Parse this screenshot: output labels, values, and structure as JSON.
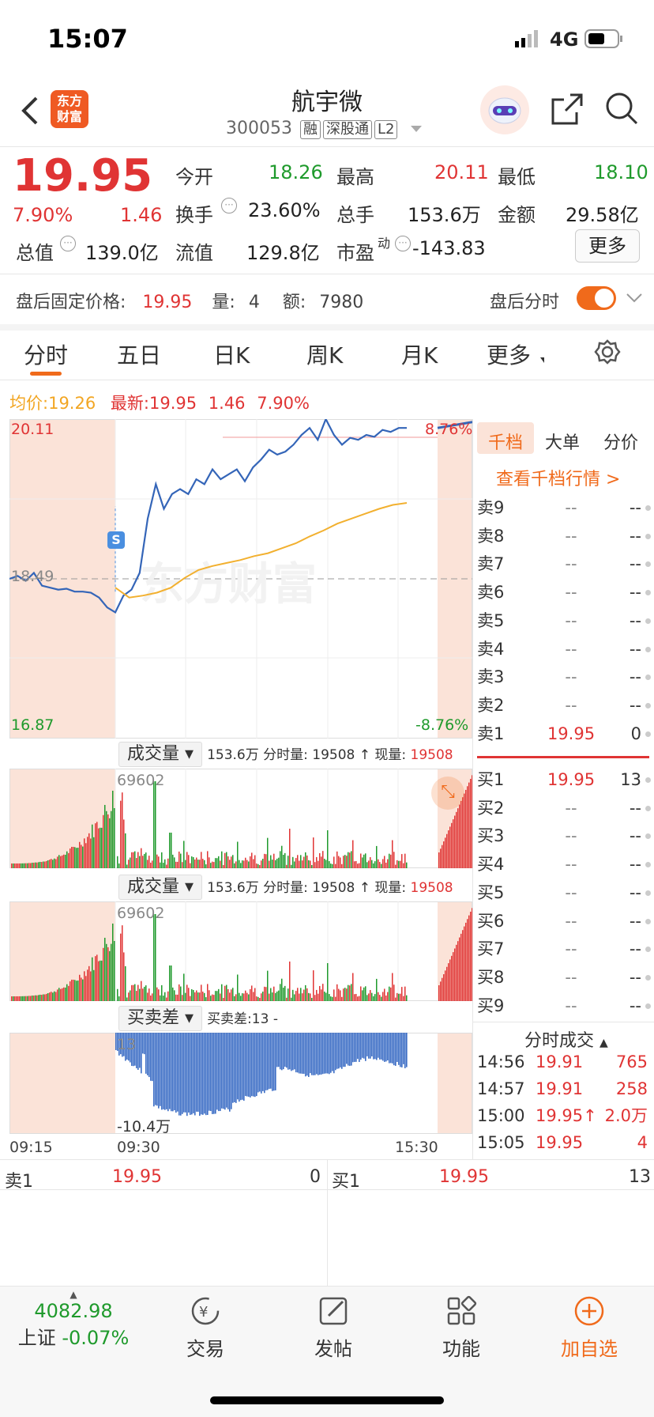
{
  "status": {
    "time": "15:07",
    "network": "4G"
  },
  "header": {
    "title": "航宇微",
    "code": "300053",
    "tags": [
      "融",
      "深股通",
      "L2"
    ],
    "logo": "东方财富"
  },
  "quote": {
    "price": "19.95",
    "pct": "7.90%",
    "chg": "1.46",
    "open_l": "今开",
    "open": "18.26",
    "high_l": "最高",
    "high": "20.11",
    "low_l": "最低",
    "low": "18.10",
    "turn_l": "换手",
    "turn": "23.60%",
    "vol_l": "总手",
    "vol": "153.6万",
    "amt_l": "金额",
    "amt": "29.58亿",
    "mcap_l": "总值",
    "mcap": "139.0亿",
    "float_l": "流值",
    "float": "129.8亿",
    "pe_l": "市盈",
    "pe_sup": "动",
    "pe": "-143.83",
    "more": "更多"
  },
  "afterhours": {
    "label": "盘后固定价格:",
    "price": "19.95",
    "vol_l": "量:",
    "vol": "4",
    "amt_l": "额:",
    "amt": "7980",
    "toggle_label": "盘后分时",
    "toggle_on": true
  },
  "tabs": [
    "分时",
    "五日",
    "日K",
    "周K",
    "月K",
    "更多"
  ],
  "legend": {
    "avg_l": "均价:",
    "avg": "19.26",
    "last_l": "最新:",
    "last": "19.95",
    "chg": "1.46",
    "pct": "7.90%"
  },
  "chart_axes": {
    "ymax": "20.11",
    "ymid": "18.49",
    "ymin": "16.87",
    "pmax": "8.76%",
    "pmin": "-8.76%",
    "t0": "09:15",
    "t1": "09:30",
    "t2": "15:30",
    "watermark": "东方财富",
    "marker": "S"
  },
  "vol_header": {
    "sel": "成交量",
    "text1": "153.6万 分时量: 19508 ↑ 现量: ",
    "cur": "19508",
    "max": "69602"
  },
  "diff_header": {
    "sel": "买卖差",
    "text": "买卖差:13 -",
    "top": "13",
    "bottom": "-10.4万"
  },
  "book_tabs": [
    "千档",
    "大单",
    "分价"
  ],
  "book_link": "查看千档行情 >",
  "sells": [
    {
      "k": "卖9",
      "p": "--",
      "q": "--"
    },
    {
      "k": "卖8",
      "p": "--",
      "q": "--"
    },
    {
      "k": "卖7",
      "p": "--",
      "q": "--"
    },
    {
      "k": "卖6",
      "p": "--",
      "q": "--"
    },
    {
      "k": "卖5",
      "p": "--",
      "q": "--"
    },
    {
      "k": "卖4",
      "p": "--",
      "q": "--"
    },
    {
      "k": "卖3",
      "p": "--",
      "q": "--"
    },
    {
      "k": "卖2",
      "p": "--",
      "q": "--"
    },
    {
      "k": "卖1",
      "p": "19.95",
      "q": "0"
    }
  ],
  "buys": [
    {
      "k": "买1",
      "p": "19.95",
      "q": "13"
    },
    {
      "k": "买2",
      "p": "--",
      "q": "--"
    },
    {
      "k": "买3",
      "p": "--",
      "q": "--"
    },
    {
      "k": "买4",
      "p": "--",
      "q": "--"
    },
    {
      "k": "买5",
      "p": "--",
      "q": "--"
    },
    {
      "k": "买6",
      "p": "--",
      "q": "--"
    },
    {
      "k": "买7",
      "p": "--",
      "q": "--"
    },
    {
      "k": "买8",
      "p": "--",
      "q": "--"
    },
    {
      "k": "买9",
      "p": "--",
      "q": "--"
    }
  ],
  "ticks_title": "分时成交",
  "ticks": [
    {
      "t": "14:56",
      "p": "19.91",
      "q": "765"
    },
    {
      "t": "14:57",
      "p": "19.91",
      "q": "258"
    },
    {
      "t": "15:00",
      "p": "19.95↑",
      "q": "2.0万"
    },
    {
      "t": "15:05",
      "p": "19.95",
      "q": "4"
    }
  ],
  "level1": {
    "sell_l": "卖1",
    "sell_p": "19.95",
    "sell_q": "0",
    "buy_l": "买1",
    "buy_p": "19.95",
    "buy_q": "13"
  },
  "bottom": {
    "index_val": "4082.98",
    "index_name": "上证",
    "index_pct": "-0.07%",
    "items": [
      "交易",
      "发帖",
      "功能",
      "加自选"
    ]
  },
  "chart_data": {
    "type": "line",
    "series": [
      {
        "name": "最新",
        "values": [
          18.49,
          18.52,
          18.47,
          18.55,
          18.42,
          18.4,
          18.38,
          18.39,
          18.36,
          18.36,
          18.35,
          18.3,
          18.2,
          18.15,
          18.32,
          18.38,
          18.55,
          19.1,
          19.45,
          19.2,
          19.35,
          19.4,
          19.35,
          19.5,
          19.45,
          19.6,
          19.5,
          19.55,
          19.6,
          19.48,
          19.62,
          19.7,
          19.8,
          19.75,
          19.78,
          19.85,
          19.95,
          20.02,
          19.9,
          20.11,
          19.95,
          19.85,
          19.92,
          19.9,
          19.95,
          19.93,
          20.0,
          19.98,
          20.02,
          20.02
        ]
      },
      {
        "name": "均价",
        "values": [
          18.4,
          18.3,
          18.32,
          18.35,
          18.4,
          18.5,
          18.58,
          18.62,
          18.65,
          18.68,
          18.72,
          18.75,
          18.8,
          18.85,
          18.92,
          18.98,
          19.05,
          19.1,
          19.15,
          19.2,
          19.24,
          19.26
        ]
      }
    ],
    "ylim": [
      16.87,
      20.11
    ]
  }
}
